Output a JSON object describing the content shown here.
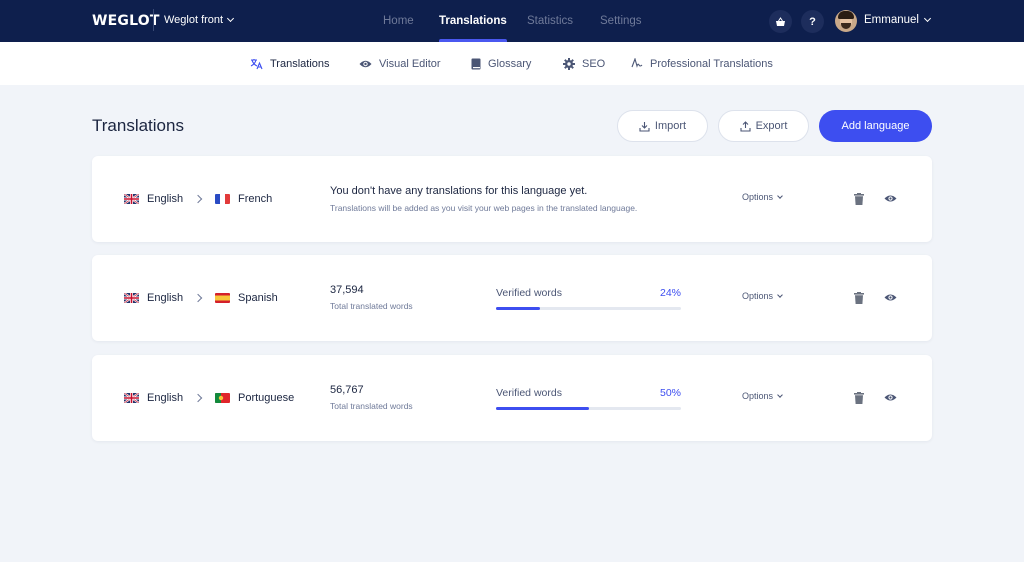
{
  "brand": "WEGLOT",
  "project": "Weglot front",
  "main_nav": [
    "Home",
    "Translations",
    "Statistics",
    "Settings"
  ],
  "user": {
    "name": "Emmanuel"
  },
  "top_icons": [
    "basket-icon",
    "help-icon"
  ],
  "help_label": "?",
  "sub_nav": [
    "Translations",
    "Visual Editor",
    "Glossary",
    "SEO",
    "Professional Translations"
  ],
  "page": {
    "title": "Translations",
    "import_label": "Import",
    "export_label": "Export",
    "add_label": "Add language"
  },
  "colors": {
    "nav_bg": "#0e1f4d",
    "accent": "#3d4ef0",
    "page_bg": "#f1f4f9"
  },
  "translations": [
    {
      "source": "English",
      "target": "French",
      "empty_title": "You don't have any translations for this language yet.",
      "empty_sub": "Translations will be added as you visit your web pages in the translated language.",
      "options": "Options"
    },
    {
      "source": "English",
      "target": "Spanish",
      "words": "37,594",
      "words_label": "Total translated words",
      "verified_label": "Verified words",
      "verified_pct": "24%",
      "verified_fraction": 0.24,
      "options": "Options"
    },
    {
      "source": "English",
      "target": "Portuguese",
      "words": "56,767",
      "words_label": "Total translated words",
      "verified_label": "Verified words",
      "verified_pct": "50%",
      "verified_fraction": 0.5,
      "options": "Options"
    }
  ]
}
